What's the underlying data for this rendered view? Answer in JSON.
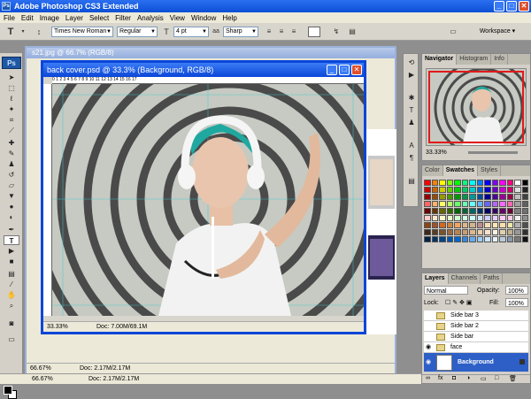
{
  "window": {
    "title": "Adobe Photoshop CS3 Extended",
    "app_icon": "Ps"
  },
  "window_buttons": [
    "_",
    "□",
    "✕"
  ],
  "menu": [
    "File",
    "Edit",
    "Image",
    "Layer",
    "Select",
    "Filter",
    "Analysis",
    "View",
    "Window",
    "Help"
  ],
  "options": {
    "font_family": "Times New Roman",
    "font_style": "Regular",
    "font_size": "4 pt",
    "anti_alias": "Sharp",
    "workspace": "Workspace ▾"
  },
  "toolbox": {
    "logo": "Ps"
  },
  "doc_back": {
    "title": "s21.jpg @ 66.7% (RGB/8)",
    "zoom": "66.67%",
    "doc_info": "Doc: 2.17M/2.17M"
  },
  "doc_front": {
    "title": "back cover.psd @ 33.3% (Background, RGB/8)",
    "zoom": "33.33%",
    "doc_info": "Doc: 7.00M/69.1M",
    "ruler_ticks": "0    1    2    3    4    5    6    7    8    9    10    11    12    13    14    15    16    17"
  },
  "navigator": {
    "tabs": [
      "Navigator",
      "Histogram",
      "Info"
    ],
    "zoom": "33.33%"
  },
  "swatches": {
    "tabs": [
      "Color",
      "Swatches",
      "Styles"
    ],
    "colors": [
      "#ff0000",
      "#ff8000",
      "#ffff00",
      "#80ff00",
      "#00ff00",
      "#00ff80",
      "#00ffff",
      "#0080ff",
      "#0000ff",
      "#8000ff",
      "#ff00ff",
      "#ff0080",
      "#ffffff",
      "#000000",
      "#cc0000",
      "#cc6600",
      "#cccc00",
      "#66cc00",
      "#00cc00",
      "#00cc66",
      "#00cccc",
      "#0066cc",
      "#0000cc",
      "#6600cc",
      "#cc00cc",
      "#cc0066",
      "#e0e0e0",
      "#202020",
      "#990000",
      "#994c00",
      "#999900",
      "#4c9900",
      "#009900",
      "#00994c",
      "#009999",
      "#004c99",
      "#000099",
      "#4c0099",
      "#990099",
      "#99004c",
      "#c0c0c0",
      "#404040",
      "#ff6666",
      "#ffb366",
      "#ffff66",
      "#b3ff66",
      "#66ff66",
      "#66ffb3",
      "#66ffff",
      "#66b3ff",
      "#6666ff",
      "#b366ff",
      "#ff66ff",
      "#ff66b3",
      "#a0a0a0",
      "#606060",
      "#660000",
      "#663300",
      "#666600",
      "#336600",
      "#006600",
      "#006633",
      "#006666",
      "#003366",
      "#000066",
      "#330066",
      "#660066",
      "#660033",
      "#808080",
      "#707070",
      "#ffcccc",
      "#ffe6cc",
      "#ffffcc",
      "#e6ffcc",
      "#ccffcc",
      "#ccffe6",
      "#ccffff",
      "#cce6ff",
      "#ccccff",
      "#e6ccff",
      "#ffccff",
      "#ffcce6",
      "#f0f0f0",
      "#909090",
      "#8b4513",
      "#a0522d",
      "#d2691e",
      "#cd853f",
      "#f4a460",
      "#deb887",
      "#d2b48c",
      "#bc8f8f",
      "#f5deb3",
      "#ffe4b5",
      "#ffdead",
      "#eee8aa",
      "#b0b0b0",
      "#505050",
      "#3b2a1a",
      "#5a3d22",
      "#7a5230",
      "#9a6a40",
      "#b58455",
      "#c99d6e",
      "#dbb88c",
      "#e9cfac",
      "#f4e4cc",
      "#faf2e6",
      "#e0d0b0",
      "#c0b090",
      "#989898",
      "#303030",
      "#002244",
      "#003366",
      "#004488",
      "#0055aa",
      "#0066cc",
      "#3388dd",
      "#66aaee",
      "#99ccff",
      "#cce6ff",
      "#e6f2ff",
      "#bbccdd",
      "#8899aa",
      "#787878",
      "#101010"
    ]
  },
  "layers": {
    "tabs": [
      "Layers",
      "Channels",
      "Paths"
    ],
    "blend_mode": "Normal",
    "opacity_label": "Opacity:",
    "opacity": "100%",
    "lock_label": "Lock:",
    "fill_label": "Fill:",
    "fill": "100%",
    "items": [
      {
        "name": "Side bar 3",
        "type": "group"
      },
      {
        "name": "Side bar 2",
        "type": "group"
      },
      {
        "name": "Side bar",
        "type": "group"
      },
      {
        "name": "face",
        "type": "group"
      },
      {
        "name": "Background",
        "type": "background"
      }
    ]
  },
  "status": {
    "zoom": "66.67%",
    "doc_info": "Doc: 2.17M/2.17M"
  }
}
